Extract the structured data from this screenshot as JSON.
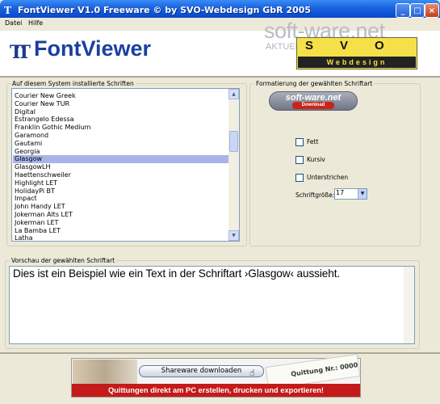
{
  "window": {
    "title": "FontViewer V1.0    Freeware © by SVO-Webdesign GbR 2005",
    "buttons": {
      "minimize": "_",
      "maximize": "□",
      "close": "×"
    }
  },
  "menu": {
    "items": [
      "Datei",
      "Hilfe"
    ]
  },
  "header": {
    "logo_glyph": "TT",
    "app_name": "FontViewer",
    "watermark_main": "soft-ware.net",
    "watermark_sub": "AKTUELLE DOWNLOADS",
    "svo_letters": "SVO",
    "svo_caption": "Webdesign"
  },
  "font_list": {
    "legend": "Auf diesem System installierte Schriften",
    "items": [
      "Courier New Greek",
      "Courier New TUR",
      "Digital",
      "Estrangelo Edessa",
      "Franklin Gothic Medium",
      "Garamond",
      "Gautami",
      "Georgia",
      "Glasgow",
      "GlasgowLH",
      "Haettenschweiler",
      "Highlight LET",
      "HolidayPi BT",
      "Impact",
      "John Handy LET",
      "Jokerman Alts LET",
      "Jokerman LET",
      "La Bamba LET",
      "Latha"
    ],
    "selected": "Glasgow"
  },
  "format": {
    "legend": "Formatierung der gewählten Schriftart",
    "badge_text": "soft-ware.net",
    "badge_sub": "Download",
    "bold_label": "Fett",
    "italic_label": "Kursiv",
    "underline_label": "Unterstrichen",
    "size_label": "Schriftgröße:",
    "size_value": "17"
  },
  "preview": {
    "legend": "Vorschau der gewählten Schriftart",
    "text": "Dies ist ein Beispiel wie ein Text in der Schriftart ›Glasgow‹ aussieht."
  },
  "ad": {
    "button_label": "Shareware downloaden",
    "receipt_text": "Quittung Nr.: 0000",
    "slogan": "Quittungen direkt am PC erstellen, drucken und exportieren!"
  }
}
